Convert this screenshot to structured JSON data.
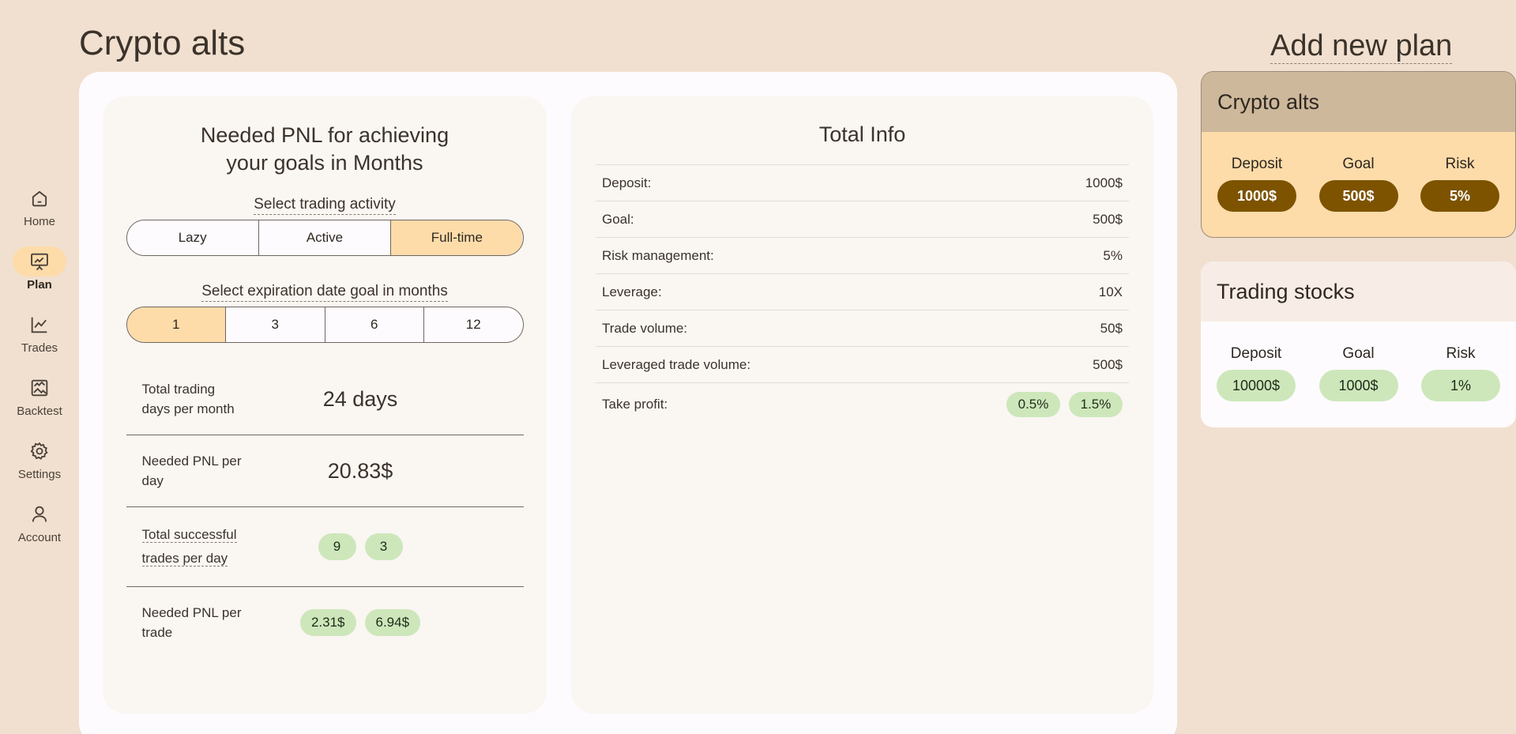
{
  "page": {
    "title": "Crypto alts",
    "add_plan_label": "Add new plan"
  },
  "sidebar": {
    "items": [
      {
        "label": "Home",
        "icon": "home-icon",
        "active": false
      },
      {
        "label": "Plan",
        "icon": "presentation-icon",
        "active": true
      },
      {
        "label": "Trades",
        "icon": "chart-line-icon",
        "active": false
      },
      {
        "label": "Backtest",
        "icon": "image-chart-icon",
        "active": false
      },
      {
        "label": "Settings",
        "icon": "gear-icon",
        "active": false
      },
      {
        "label": "Account",
        "icon": "person-icon",
        "active": false
      }
    ]
  },
  "left_panel": {
    "title_line1": "Needed PNL for achieving",
    "title_line2": "your goals in Months",
    "activity_label": "Select trading activity",
    "activity_options": [
      "Lazy",
      "Active",
      "Full-time"
    ],
    "activity_selected": "Full-time",
    "expiration_label": "Select expiration date goal in months",
    "expiration_options": [
      "1",
      "3",
      "6",
      "12"
    ],
    "expiration_selected": "1",
    "stats": {
      "trading_days_label_1": "Total trading",
      "trading_days_label_2": "days per month",
      "trading_days_value": "24 days",
      "pnl_day_label_1": "Needed PNL per",
      "pnl_day_label_2": "day",
      "pnl_day_value": "20.83$",
      "successful_label_1": "Total successful",
      "successful_label_2": "trades per day",
      "successful_values": [
        "9",
        "3"
      ],
      "pnl_trade_label_1": "Needed PNL per",
      "pnl_trade_label_2": "trade",
      "pnl_trade_values": [
        "2.31$",
        "6.94$"
      ]
    }
  },
  "total_info": {
    "title": "Total Info",
    "rows": [
      {
        "label": "Deposit:",
        "value": "1000$"
      },
      {
        "label": "Goal:",
        "value": "500$"
      },
      {
        "label": "Risk management:",
        "value": "5%"
      },
      {
        "label": "Leverage:",
        "value": "10X"
      },
      {
        "label": "Trade volume:",
        "value": "50$"
      },
      {
        "label": "Leveraged trade volume:",
        "value": "500$"
      }
    ],
    "take_profit_label": "Take profit:",
    "take_profit_values": [
      "0.5%",
      "1.5%"
    ]
  },
  "plans": [
    {
      "name": "Crypto alts",
      "deposit_label": "Deposit",
      "deposit": "1000$",
      "goal_label": "Goal",
      "goal": "500$",
      "risk_label": "Risk",
      "risk": "5%"
    },
    {
      "name": "Trading stocks",
      "deposit_label": "Deposit",
      "deposit": "10000$",
      "goal_label": "Goal",
      "goal": "1000$",
      "risk_label": "Risk",
      "risk": "1%"
    }
  ],
  "colors": {
    "background": "#f1e0cf",
    "accent": "#fddcaa",
    "active_pill": "#7d5300",
    "chip_green": "#cde7bb"
  }
}
